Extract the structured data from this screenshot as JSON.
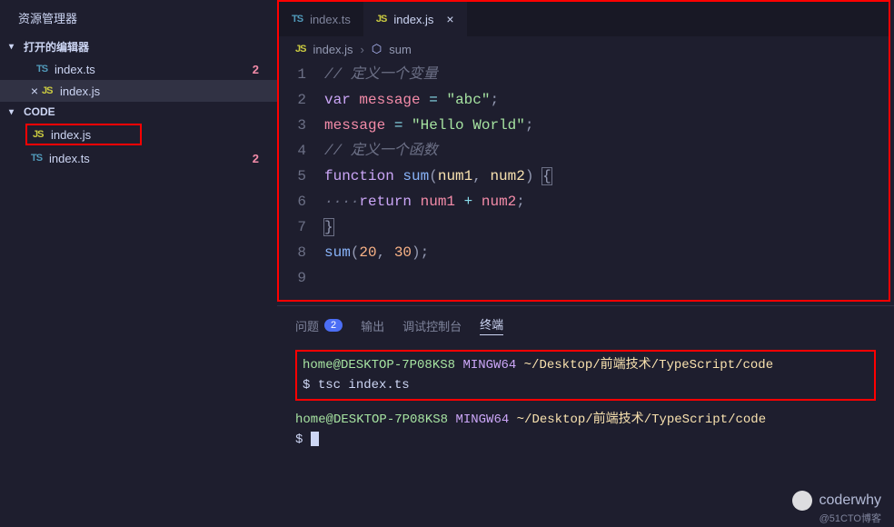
{
  "sidebar": {
    "title": "资源管理器",
    "openEditors": {
      "label": "打开的编辑器",
      "items": [
        {
          "icon": "TS",
          "name": "index.ts",
          "badge": "2",
          "closable": false
        },
        {
          "icon": "JS",
          "name": "index.js",
          "badge": "",
          "closable": true
        }
      ]
    },
    "workspace": {
      "label": "CODE",
      "items": [
        {
          "icon": "JS",
          "name": "index.js",
          "badge": "",
          "highlighted": true
        },
        {
          "icon": "TS",
          "name": "index.ts",
          "badge": "2",
          "highlighted": false
        }
      ]
    }
  },
  "tabs": [
    {
      "icon": "TS",
      "name": "index.ts",
      "active": false
    },
    {
      "icon": "JS",
      "name": "index.js",
      "active": true
    }
  ],
  "breadcrumb": {
    "file": "index.js",
    "symbol": "sum"
  },
  "code": {
    "lines": [
      {
        "n": "1",
        "type": "comment",
        "text": "// 定义一个变量"
      },
      {
        "n": "2",
        "type": "vardecl",
        "kw": "var",
        "name": "message",
        "op": "=",
        "val": "\"abc\""
      },
      {
        "n": "3",
        "type": "assign",
        "name": "message",
        "op": "=",
        "val": "\"Hello World\""
      },
      {
        "n": "4",
        "type": "comment",
        "text": "// 定义一个函数"
      },
      {
        "n": "5",
        "type": "funcdecl",
        "kw": "function",
        "name": "sum",
        "params": [
          "num1",
          "num2"
        ]
      },
      {
        "n": "6",
        "type": "return",
        "kw": "return",
        "expr": [
          "num1",
          "+",
          "num2"
        ]
      },
      {
        "n": "7",
        "type": "closebrace"
      },
      {
        "n": "8",
        "type": "call",
        "name": "sum",
        "args": [
          "20",
          "30"
        ]
      },
      {
        "n": "9",
        "type": "blank"
      }
    ]
  },
  "panel": {
    "tabs": {
      "problems": "问题",
      "problemsCount": "2",
      "output": "输出",
      "debug": "调试控制台",
      "terminal": "终端"
    }
  },
  "terminal": {
    "blocks": [
      {
        "prompt": {
          "user": "home@DESKTOP-7P08KS8",
          "sys": "MINGW64",
          "path": "~/Desktop/前端技术/TypeScript/code"
        },
        "cmd": "tsc index.ts",
        "highlighted": true
      },
      {
        "prompt": {
          "user": "home@DESKTOP-7P08KS8",
          "sys": "MINGW64",
          "path": "~/Desktop/前端技术/TypeScript/code"
        },
        "cmd": "",
        "highlighted": false
      }
    ]
  },
  "watermark": "coderwhy",
  "attribution": "@51CTO博客"
}
